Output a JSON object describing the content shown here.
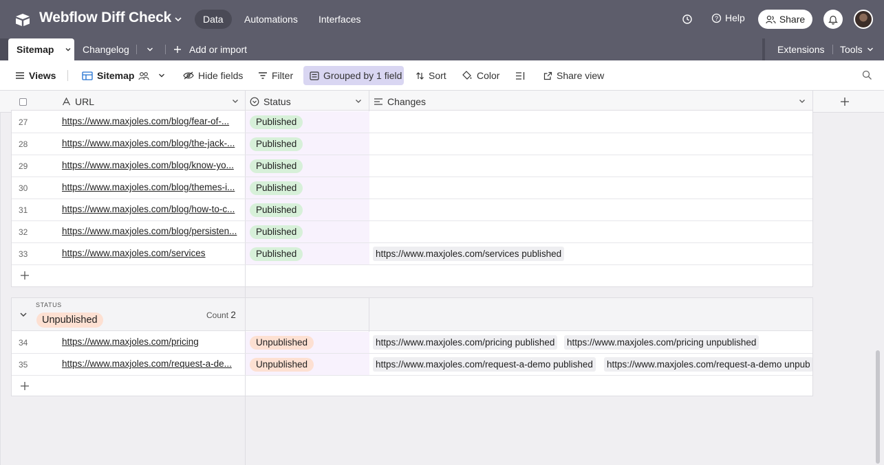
{
  "app": {
    "title": "Webflow Diff Check",
    "nav_tabs": [
      {
        "label": "Data",
        "active": true
      },
      {
        "label": "Automations",
        "active": false
      },
      {
        "label": "Interfaces",
        "active": false
      }
    ],
    "help_label": "Help",
    "share_label": "Share"
  },
  "tables": {
    "tabs": [
      "Sitemap",
      "Changelog"
    ],
    "add_label": "Add or import",
    "extensions_label": "Extensions",
    "tools_label": "Tools"
  },
  "toolbar": {
    "views_label": "Views",
    "view_name": "Sitemap",
    "hide_fields": "Hide fields",
    "filter": "Filter",
    "grouped": "Grouped by 1 field",
    "sort": "Sort",
    "color": "Color",
    "share_view": "Share view"
  },
  "columns": {
    "url": "URL",
    "status": "Status",
    "changes": "Changes"
  },
  "groups": {
    "published_rows": [
      {
        "num": "27",
        "url": "https://www.maxjoles.com/blog/fear-of-...",
        "status": "Published",
        "changes": []
      },
      {
        "num": "28",
        "url": "https://www.maxjoles.com/blog/the-jack-...",
        "status": "Published",
        "changes": []
      },
      {
        "num": "29",
        "url": "https://www.maxjoles.com/blog/know-yo...",
        "status": "Published",
        "changes": []
      },
      {
        "num": "30",
        "url": "https://www.maxjoles.com/blog/themes-i...",
        "status": "Published",
        "changes": []
      },
      {
        "num": "31",
        "url": "https://www.maxjoles.com/blog/how-to-c...",
        "status": "Published",
        "changes": []
      },
      {
        "num": "32",
        "url": "https://www.maxjoles.com/blog/persisten...",
        "status": "Published",
        "changes": []
      },
      {
        "num": "33",
        "url": "https://www.maxjoles.com/services",
        "status": "Published",
        "changes": [
          "https://www.maxjoles.com/services published"
        ]
      }
    ],
    "unpublished": {
      "field_label": "STATUS",
      "value": "Unpublished",
      "count_label": "Count",
      "count": "2",
      "rows": [
        {
          "num": "34",
          "url": "https://www.maxjoles.com/pricing",
          "status": "Unpublished",
          "changes": [
            "https://www.maxjoles.com/pricing published",
            "https://www.maxjoles.com/pricing unpublished"
          ]
        },
        {
          "num": "35",
          "url": "https://www.maxjoles.com/request-a-de...",
          "status": "Unpublished",
          "changes": [
            "https://www.maxjoles.com/request-a-demo published",
            "https://www.maxjoles.com/request-a-demo unpub"
          ]
        }
      ]
    }
  },
  "colors": {
    "header_bg": "#5d5d6b",
    "published_pill": "#d7f0d9",
    "unpublished_pill": "#fde0d2",
    "status_column_tint": "#f8f2fd",
    "grouped_button": "#d9d6f2"
  },
  "icons": [
    "airtable-logo-icon",
    "chevron-down-icon",
    "history-icon",
    "help-icon",
    "share-users-icon",
    "bell-icon",
    "plus-icon",
    "hamburger-icon",
    "grid-view-icon",
    "people-icon",
    "eye-slash-icon",
    "filter-icon",
    "group-icon",
    "sort-icon",
    "paint-bucket-icon",
    "row-height-icon",
    "external-link-icon",
    "search-icon",
    "text-field-icon",
    "single-select-icon",
    "long-text-icon"
  ]
}
